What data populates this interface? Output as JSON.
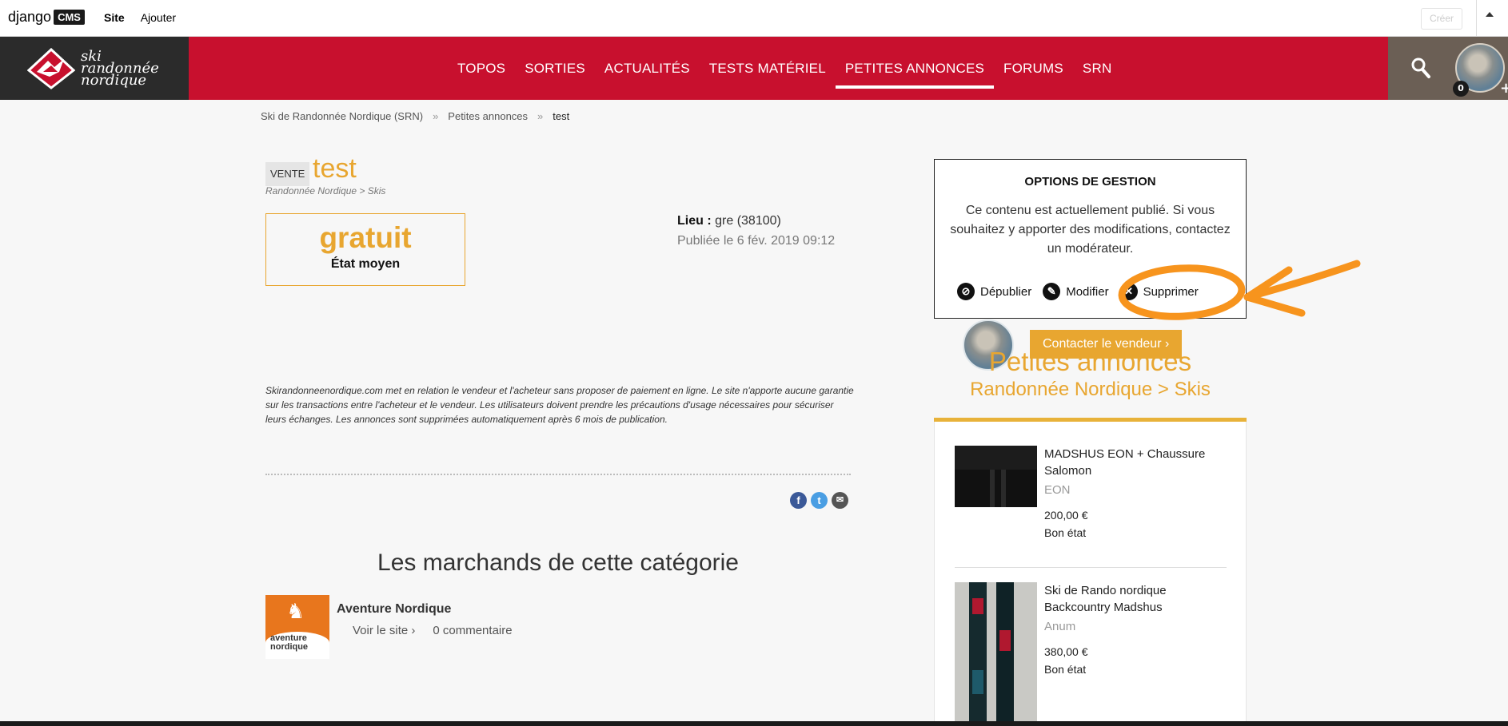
{
  "cms_toolbar": {
    "logo_text": "django",
    "logo_box": "CMS",
    "menu": [
      "Site",
      "Ajouter"
    ],
    "create_button": "Créer"
  },
  "header": {
    "brand_lines": [
      "ski",
      "randonnée",
      "nordique"
    ],
    "nav": [
      {
        "label": "TOPOS",
        "active": false
      },
      {
        "label": "SORTIES",
        "active": false
      },
      {
        "label": "ACTUALITÉS",
        "active": false
      },
      {
        "label": "TESTS MATÉRIEL",
        "active": false
      },
      {
        "label": "PETITES ANNONCES",
        "active": true
      },
      {
        "label": "FORUMS",
        "active": false
      },
      {
        "label": "SRN",
        "active": false
      }
    ],
    "user_count": "0",
    "accent": "#c8102e"
  },
  "breadcrumb": {
    "items": [
      "Ski de Randonnée Nordique (SRN)",
      "Petites annonces"
    ],
    "separator": "»",
    "current": "test"
  },
  "ad": {
    "type_badge": "VENTE",
    "title": "test",
    "category": "Randonnée Nordique > Skis",
    "price": "gratuit",
    "condition": "État moyen",
    "location_label": "Lieu :",
    "location_value": "gre (38100)",
    "published": "Publiée le 6 fév. 2019 09:12",
    "disclaimer": "Skirandonneenordique.com met en relation le vendeur et l'acheteur sans proposer de paiement en ligne. Le site n'apporte aucune garantie sur les transactions entre l'acheteur et le vendeur. Les utilisateurs doivent prendre les précautions d'usage nécessaires pour sécuriser leurs échanges. Les annonces sont supprimées automatiquement après 6 mois de publication.",
    "share_icons": [
      "facebook-icon",
      "twitter-icon",
      "mail-icon"
    ],
    "highlight": "#e8a630"
  },
  "merchants": {
    "title": "Les marchands de cette catégorie",
    "items": [
      {
        "name": "Aventure Nordique",
        "logo_text": "aventure nordique",
        "site_link": "Voir le site",
        "comments": "0 commentaire"
      }
    ]
  },
  "management": {
    "title": "OPTIONS DE GESTION",
    "text": "Ce contenu est actuellement publié. Si vous souhaitez y apporter des modifications, contactez un modérateur.",
    "actions": [
      "Dépublier",
      "Modifier",
      "Supprimer"
    ],
    "contact_button": "Contacter le vendeur"
  },
  "sidebar": {
    "title": "Petites annonces",
    "subtitle": "Randonnée Nordique > Skis",
    "items": [
      {
        "title": "MADSHUS EON + Chaussure Salomon",
        "model": "EON",
        "price": "200,00 €",
        "condition": "Bon état"
      },
      {
        "title": "Ski de Rando nordique Backcountry Madshus",
        "model": "Anum",
        "price": "380,00 €",
        "condition": "Bon état"
      }
    ]
  },
  "annotation_color": "#f7941d"
}
